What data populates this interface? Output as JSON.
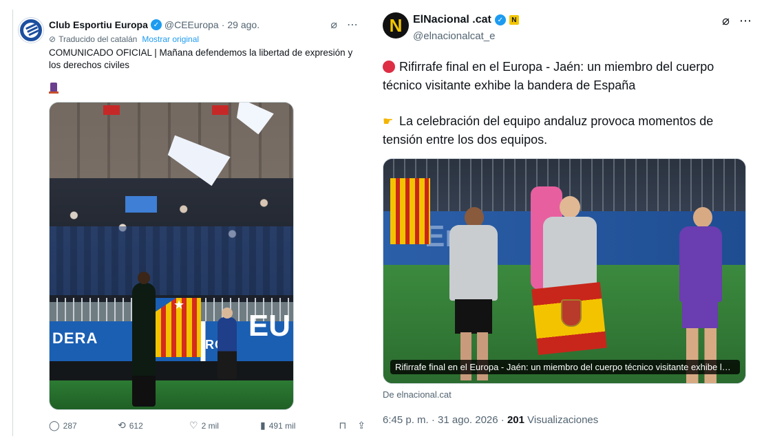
{
  "left_tweet": {
    "author_name": "Club Esportiu Europa",
    "handle": "@CEEuropa",
    "separator": "·",
    "date": "29 ago.",
    "translated_label": "Traducido del catalán",
    "show_original": "Mostrar original",
    "text": "COMUNICADO OFICIAL | Mañana defendemos la libertad de expresión y los derechos civiles",
    "photo_banner_text": "DERA",
    "photo_banner_text2": "EU",
    "photo_banner_text3": "CRO",
    "actions": {
      "replies": "287",
      "retweets": "612",
      "likes": "2 mil",
      "views": "491 mil"
    }
  },
  "right_tweet": {
    "author_name": "ElNacional .cat",
    "badge": "N",
    "handle": "@elnacionalcat_e",
    "paragraph1": "Rifirrafe final en el Europa - Jaén: un miembro del cuerpo técnico visitante exhibe la bandera de España",
    "paragraph2": "La celebración del equipo andaluz provoca momentos de tensión entre los dos equipos.",
    "card_caption": "Rifirrafe final en el Europa - Jaén: un miembro del cuerpo técnico visitante exhibe la bandera de España",
    "card_board_text": "Ena",
    "source": "De elnacional.cat",
    "timestamp": "6:45 p. m. · 31 ago. 2026 ·",
    "views_count": "201",
    "views_label": "Visualizaciones"
  },
  "icons": {
    "verified": "verified-badge-icon",
    "grok": "grok-icon",
    "more": "more-icon",
    "reply": "reply-icon",
    "retweet": "retweet-icon",
    "like": "like-icon",
    "views": "views-icon",
    "bookmark": "bookmark-icon",
    "share": "share-icon"
  },
  "colors": {
    "link": "#1d9bf0",
    "text_secondary": "#536471",
    "text_primary": "#0f1419"
  }
}
